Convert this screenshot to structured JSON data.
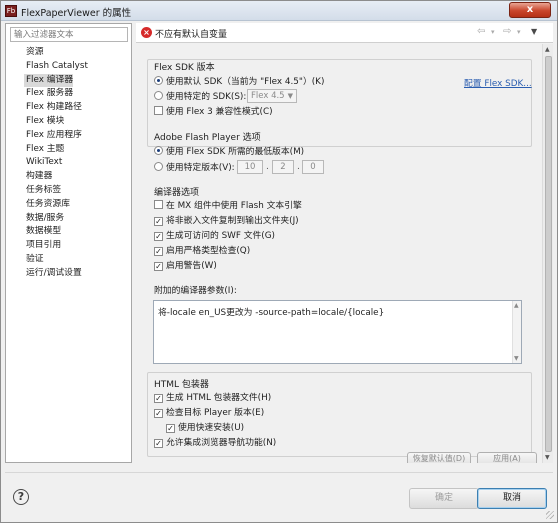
{
  "window": {
    "title": "FlexPaperViewer 的属性",
    "close_label": "x"
  },
  "filter": {
    "placeholder": "输入过滤器文本"
  },
  "nav_items": [
    "资源",
    "Flash Catalyst",
    "Flex 编译器",
    "Flex 服务器",
    "Flex 构建路径",
    "Flex 模块",
    "Flex 应用程序",
    "Flex 主题",
    "WikiText",
    "构建器",
    "任务标签",
    "任务资源库",
    "数据/服务",
    "数据模型",
    "项目引用",
    "验证",
    "运行/调试设置"
  ],
  "selected_nav_index": 2,
  "header": {
    "error_text": "不应有默认自变量"
  },
  "sdk": {
    "title": "Flex SDK 版本",
    "default_sdk_label": "使用默认 SDK（当前为 \"Flex 4.5\"）(K)",
    "specific_sdk_label": "使用特定的 SDK(S):",
    "specific_sdk_value": "Flex 4.5",
    "configure_link": "配置 Flex SDK...",
    "flex3_compat_label": "使用 Flex 3 兼容性模式(C)"
  },
  "flash_player": {
    "title": "Adobe Flash Player 选项",
    "min_version_label": "使用 Flex SDK 所需的最低版本(M)",
    "specific_version_label": "使用特定版本(V):",
    "version_parts": [
      "10",
      "2",
      "0"
    ]
  },
  "compiler": {
    "title": "编译器选项",
    "options": [
      {
        "label": "在 MX 组件中使用 Flash 文本引擎",
        "checked": false
      },
      {
        "label": "将非嵌入文件复制到输出文件夹(J)",
        "checked": true
      },
      {
        "label": "生成可访问的 SWF 文件(G)",
        "checked": true
      },
      {
        "label": "启用严格类型检查(Q)",
        "checked": true
      },
      {
        "label": "启用警告(W)",
        "checked": true
      }
    ],
    "extra_args_label": "附加的编译器参数(I):",
    "extra_args_value": "将-locale en_US更改为 -source-path=locale/{locale}"
  },
  "html_wrapper": {
    "title": "HTML 包装器",
    "options": [
      {
        "label": "生成 HTML 包装器文件(H)",
        "checked": true
      },
      {
        "label": "检查目标 Player 版本(E)",
        "checked": true
      },
      {
        "label": "使用快速安装(U)",
        "checked": true
      },
      {
        "label": "允许集成浏览器导航功能(N)",
        "checked": true
      }
    ]
  },
  "partial_buttons": [
    "恢复默认值(D)",
    "应用(A)"
  ],
  "footer": {
    "ok_label": "确定",
    "cancel_label": "取消"
  }
}
